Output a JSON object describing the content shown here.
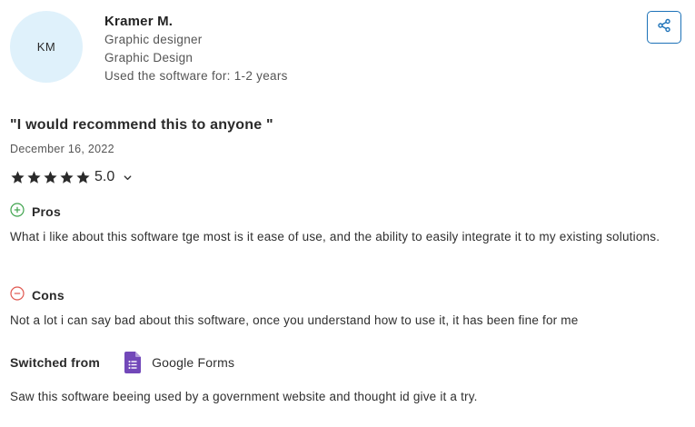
{
  "reviewer": {
    "initials": "KM",
    "name": "Kramer M.",
    "role": "Graphic designer",
    "industry": "Graphic Design",
    "usage": "Used the software for: 1-2 years"
  },
  "review": {
    "title": "\"I would recommend this to anyone \"",
    "date": "December 16, 2022",
    "rating": {
      "score": "5.0",
      "value": 5,
      "max": 5
    },
    "pros": {
      "label": "Pros",
      "text": "What i like about this software tge most is it ease of use, and the ability to easily integrate it to my existing solutions."
    },
    "cons": {
      "label": "Cons",
      "text": "Not a lot i can say bad about this software, once you understand how to use it, it has been fine for me"
    },
    "switched": {
      "label": "Switched from",
      "product": "Google Forms",
      "reason": "Saw this software beeing used by a government website and thought id give it a try."
    }
  },
  "icons": {
    "share": "share-icon",
    "star": "star-icon",
    "chevron": "chevron-down-icon",
    "pros": "plus-circle-icon",
    "cons": "minus-circle-icon",
    "product": "google-forms-icon"
  },
  "colors": {
    "avatar_bg": "#dff1fb",
    "share_blue": "#1d72b8",
    "pros_green": "#3fa34d",
    "cons_red": "#e0574f",
    "forms_purple": "#7248b9",
    "star": "#2a2a2a"
  }
}
